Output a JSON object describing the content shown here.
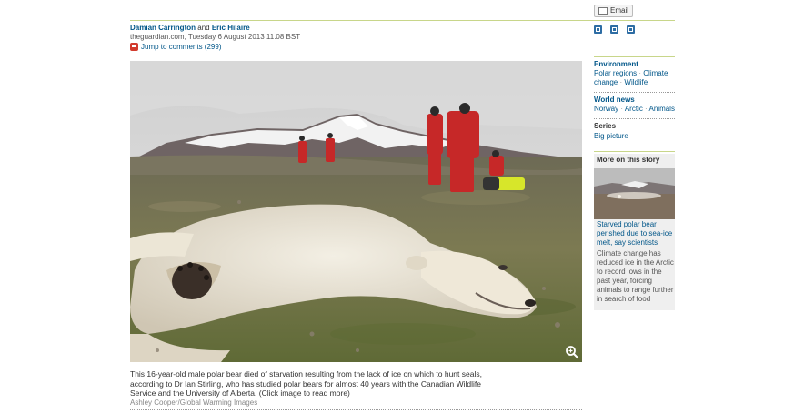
{
  "byline": {
    "author1": "Damian Carrington",
    "and": "and",
    "author2": "Eric Hilaire",
    "dateline": "theguardian.com, Tuesday 6 August 2013 11.08 BST",
    "comments_label": "Jump to comments (299)"
  },
  "photo": {
    "alt": "Dead polar bear lying on tundra with researchers in red suits and snowy mountains in background"
  },
  "caption": {
    "text": "This 16-year-old male polar bear died of starvation resulting from the lack of ice on which to hunt seals, according to Dr Ian Stirling, who has studied polar bears for almost 40 years with the Canadian Wildlife Service and the University of Alberta. (Click image to read more)",
    "credit": "Ashley Cooper/Global Warming Images"
  },
  "sidebar": {
    "email_label": "Email",
    "environment": {
      "title": "Environment",
      "links": [
        "Polar regions",
        "Climate change",
        "Wildlife"
      ]
    },
    "world_news": {
      "title": "World news",
      "links": [
        "Norway",
        "Arctic",
        "Animals"
      ]
    },
    "series": {
      "title": "Series",
      "links": [
        "Big picture"
      ]
    },
    "more": {
      "title": "More on this story",
      "link": "Starved polar bear perished due to sea-ice melt, say scientists",
      "desc": "Climate change has reduced ice in the Arctic to record lows in the past year, forcing animals to range further in search of food"
    }
  }
}
